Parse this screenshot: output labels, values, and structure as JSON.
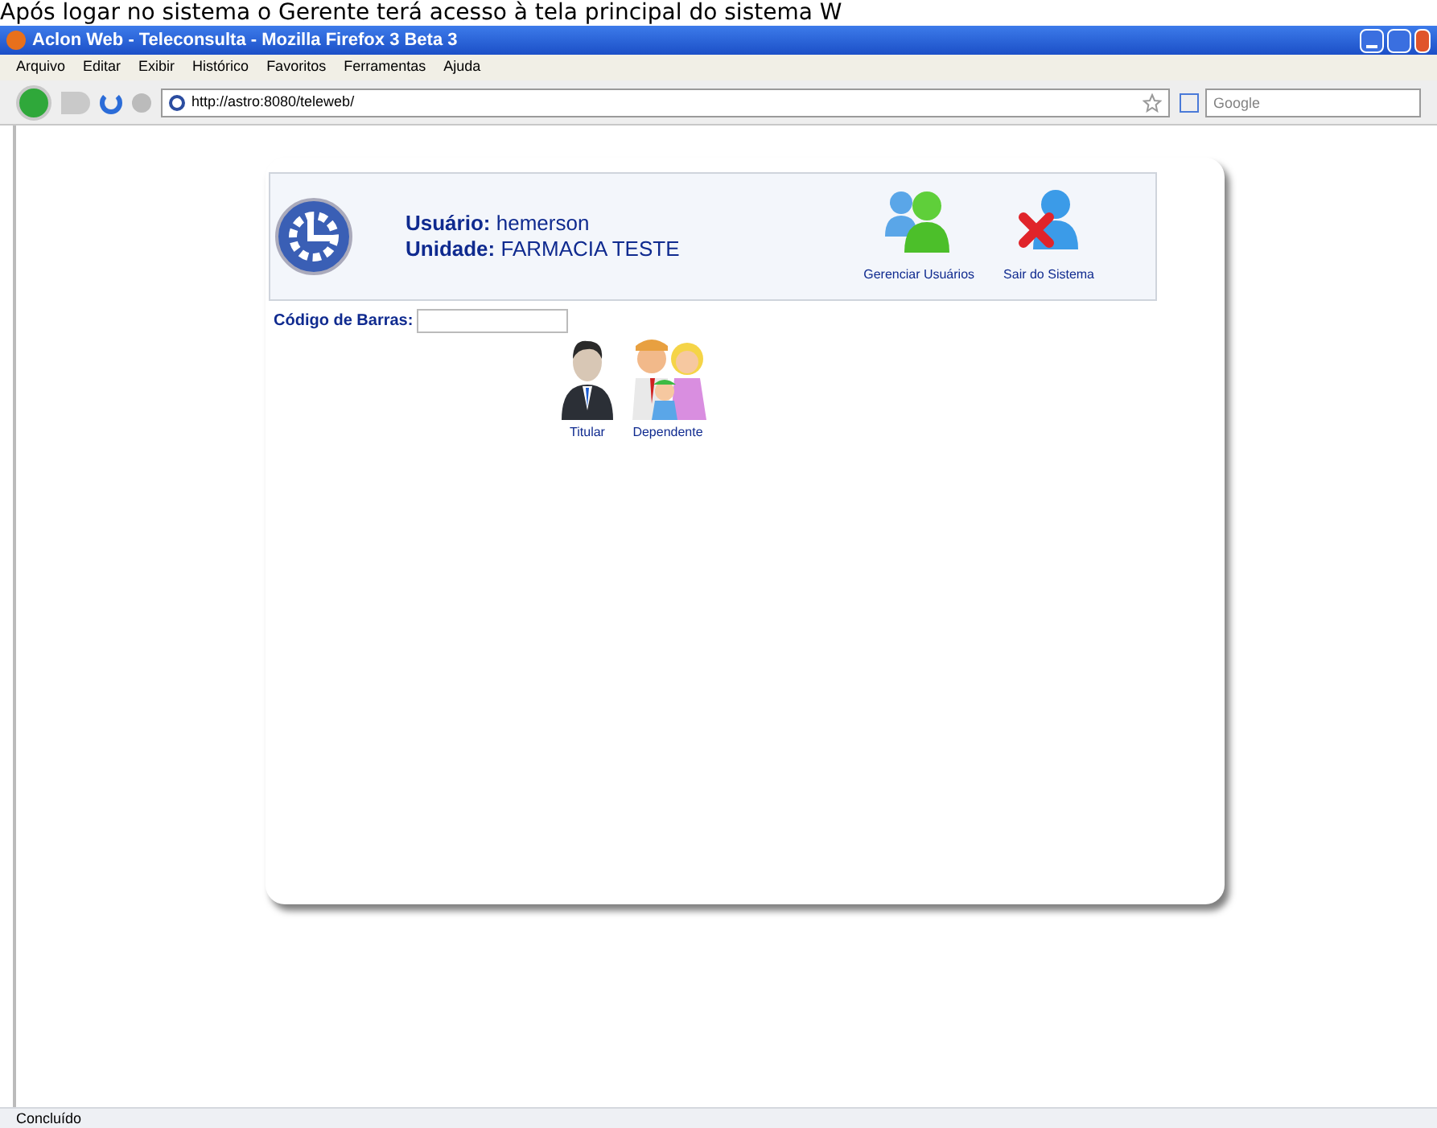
{
  "caption": "Após logar no sistema o Gerente terá acesso à tela principal do sistema W",
  "window": {
    "title": "Aclon Web - Teleconsulta - Mozilla Firefox 3 Beta 3"
  },
  "menu": [
    "Arquivo",
    "Editar",
    "Exibir",
    "Histórico",
    "Favoritos",
    "Ferramentas",
    "Ajuda"
  ],
  "address": {
    "value": "http://astro:8080/teleweb/"
  },
  "search": {
    "placeholder": "Google"
  },
  "header": {
    "user_label": "Usuário:",
    "user": "hemerson",
    "unit_label": "Unidade:",
    "unit": "FARMACIA TESTE",
    "actions": [
      {
        "kind": "users",
        "label": "Gerenciar Usuários"
      },
      {
        "kind": "exit",
        "label": "Sair do Sistema"
      }
    ]
  },
  "barcode": {
    "label": "Código de Barras:"
  },
  "options": [
    {
      "kind": "holder",
      "label": "Titular"
    },
    {
      "kind": "family",
      "label": "Dependente"
    }
  ],
  "status_bar": "Concluído"
}
